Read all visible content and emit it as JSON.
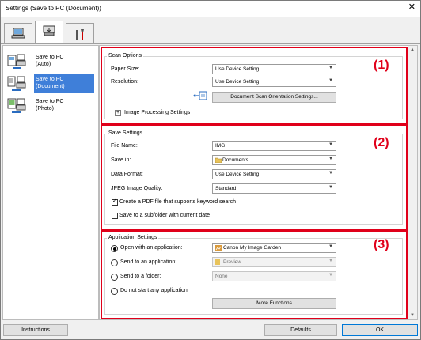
{
  "window": {
    "title": "Settings (Save to PC (Document))"
  },
  "tabs": [
    {
      "icon": "scan-from-computer-icon"
    },
    {
      "icon": "scan-from-operation-panel-icon"
    },
    {
      "icon": "general-settings-tools-icon"
    }
  ],
  "sidebar": {
    "items": [
      {
        "label": "Save to PC (Auto)",
        "line1": "Save to PC",
        "line2": "(Auto)",
        "selected": false
      },
      {
        "label": "Save to PC (Document)",
        "line1": "Save to PC",
        "line2": "(Document)",
        "selected": true
      },
      {
        "label": "Save to PC (Photo)",
        "line1": "Save to PC",
        "line2": "(Photo)",
        "selected": false
      }
    ]
  },
  "scan_options": {
    "title": "Scan Options",
    "callout": "(1)",
    "paper_size": {
      "label": "Paper Size:",
      "value": "Use Device Setting"
    },
    "resolution": {
      "label": "Resolution:",
      "value": "Use Device Setting"
    },
    "orientation_button": "Document Scan Orientation Settings...",
    "image_processing": {
      "expander": "+",
      "label": "Image Processing Settings"
    }
  },
  "save_settings": {
    "title": "Save Settings",
    "callout": "(2)",
    "file_name": {
      "label": "File Name:",
      "value": "IMG"
    },
    "save_in": {
      "label": "Save in:",
      "value": "Documents"
    },
    "data_format": {
      "label": "Data Format:",
      "value": "Use Device Setting"
    },
    "jpeg_quality": {
      "label": "JPEG Image Quality:",
      "value": "Standard"
    },
    "pdf_keyword": {
      "label": "Create a PDF file that supports keyword search",
      "checked": true
    },
    "subfolder": {
      "label": "Save to a subfolder with current date",
      "checked": false
    }
  },
  "application_settings": {
    "title": "Application Settings",
    "callout": "(3)",
    "open_with": {
      "label": "Open with an application:",
      "value": "Canon My Image Garden",
      "selected": true
    },
    "send_to_app": {
      "label": "Send to an application:",
      "value": "Preview",
      "selected": false
    },
    "send_to_folder": {
      "label": "Send to a folder:",
      "value": "None",
      "selected": false
    },
    "no_app": {
      "label": "Do not start any application",
      "selected": false
    },
    "more_functions": "More Functions"
  },
  "footer": {
    "instructions": "Instructions",
    "defaults": "Defaults",
    "ok": "OK"
  },
  "colors": {
    "callout_red": "#e0001a",
    "selection_blue": "#3f7fd9"
  }
}
